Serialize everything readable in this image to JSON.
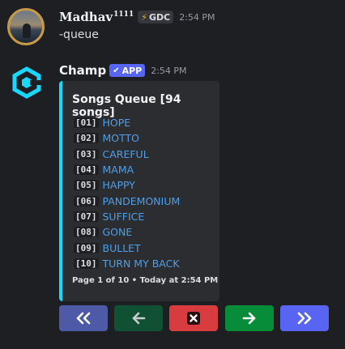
{
  "colors": {
    "background": "#1e1f23",
    "embed_accent": "#18d8ff",
    "link": "#4f9fe8",
    "app_badge": "#5865f2",
    "btn_first": "#4e5aa8",
    "btn_prev": "#0f5132",
    "btn_stop": "#d83c3e",
    "btn_next": "#078c3a",
    "btn_last": "#5865f2"
  },
  "user_message": {
    "author": "Madhav",
    "author_sup": "1111",
    "server_tag": "GDC",
    "timestamp": "2:54 PM",
    "content": "-queue"
  },
  "bot_message": {
    "author": "Champ",
    "badge": "APP",
    "timestamp": "2:54 PM",
    "embed": {
      "title": "Songs Queue [94 songs]",
      "songs": [
        {
          "index": "[01]",
          "title": "HOPE"
        },
        {
          "index": "[02]",
          "title": "MOTTO"
        },
        {
          "index": "[03]",
          "title": "CAREFUL"
        },
        {
          "index": "[04]",
          "title": "MAMA"
        },
        {
          "index": "[05]",
          "title": "HAPPY"
        },
        {
          "index": "[06]",
          "title": "PANDEMONIUM"
        },
        {
          "index": "[07]",
          "title": "SUFFICE"
        },
        {
          "index": "[08]",
          "title": "GONE"
        },
        {
          "index": "[09]",
          "title": "BULLET"
        },
        {
          "index": "[10]",
          "title": "TURN MY BACK"
        }
      ],
      "footer": "Page 1 of 10 • Today at 2:54 PM"
    },
    "buttons": [
      {
        "icon": "double-chevron-left-icon"
      },
      {
        "icon": "arrow-left-icon"
      },
      {
        "icon": "close-box-icon"
      },
      {
        "icon": "arrow-right-icon"
      },
      {
        "icon": "double-chevron-right-icon"
      }
    ]
  }
}
